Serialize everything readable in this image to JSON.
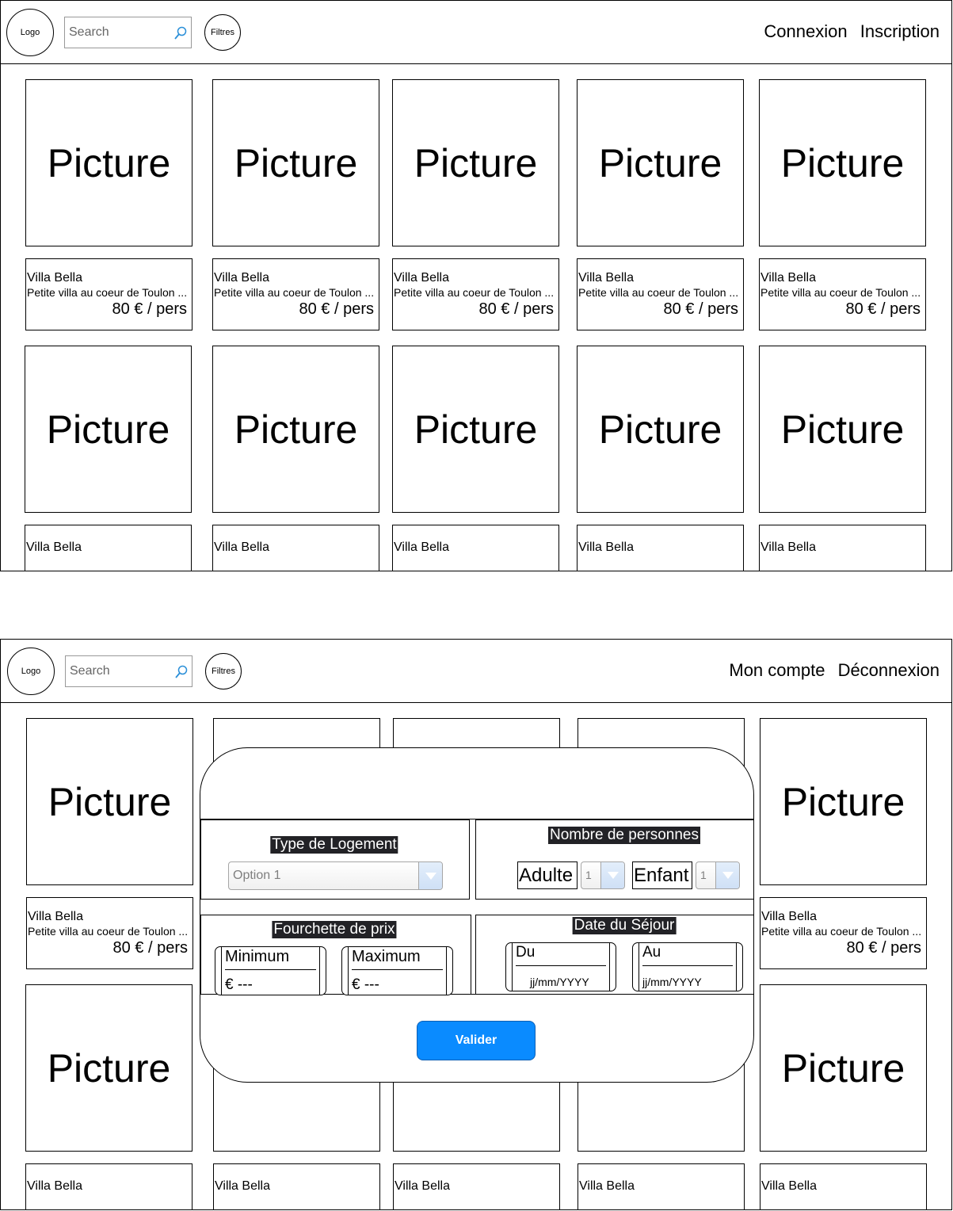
{
  "header_logged_out": {
    "logo_label": "Logo",
    "search_placeholder": "Search",
    "filters_label": "Filtres",
    "login_label": "Connexion",
    "signup_label": "Inscription"
  },
  "header_logged_in": {
    "logo_label": "Logo",
    "search_placeholder": "Search",
    "filters_label": "Filtres",
    "account_label": "Mon compte",
    "logout_label": "Déconnexion"
  },
  "listing": {
    "picture_label": "Picture",
    "name": "Villa Bella",
    "description": "Petite villa au coeur de Toulon ...",
    "price": "80 € / pers"
  },
  "filter_modal": {
    "housing_type": {
      "title": "Type de Logement",
      "selected": "Option 1"
    },
    "people": {
      "title": "Nombre de personnes",
      "adult_label": "Adulte",
      "adult_value": "1",
      "child_label": "Enfant",
      "child_value": "1"
    },
    "price_range": {
      "title": "Fourchette de prix",
      "min_label": "Minimum",
      "min_value": "€ ---",
      "max_label": "Maximum",
      "max_value": "€ ---"
    },
    "stay_dates": {
      "title": "Date du Séjour",
      "from_label": "Du",
      "from_placeholder": "jj/mm/YYYY",
      "to_label": "Au",
      "to_placeholder": "jj/mm/YYYY"
    },
    "submit_label": "Valider"
  },
  "colors": {
    "button_primary": "#0a8bff",
    "label_background": "#222226",
    "dropdown_arrow": "#5b9bd5"
  },
  "icons": {
    "search": "search-icon",
    "dropdown": "chevron-down-icon"
  }
}
